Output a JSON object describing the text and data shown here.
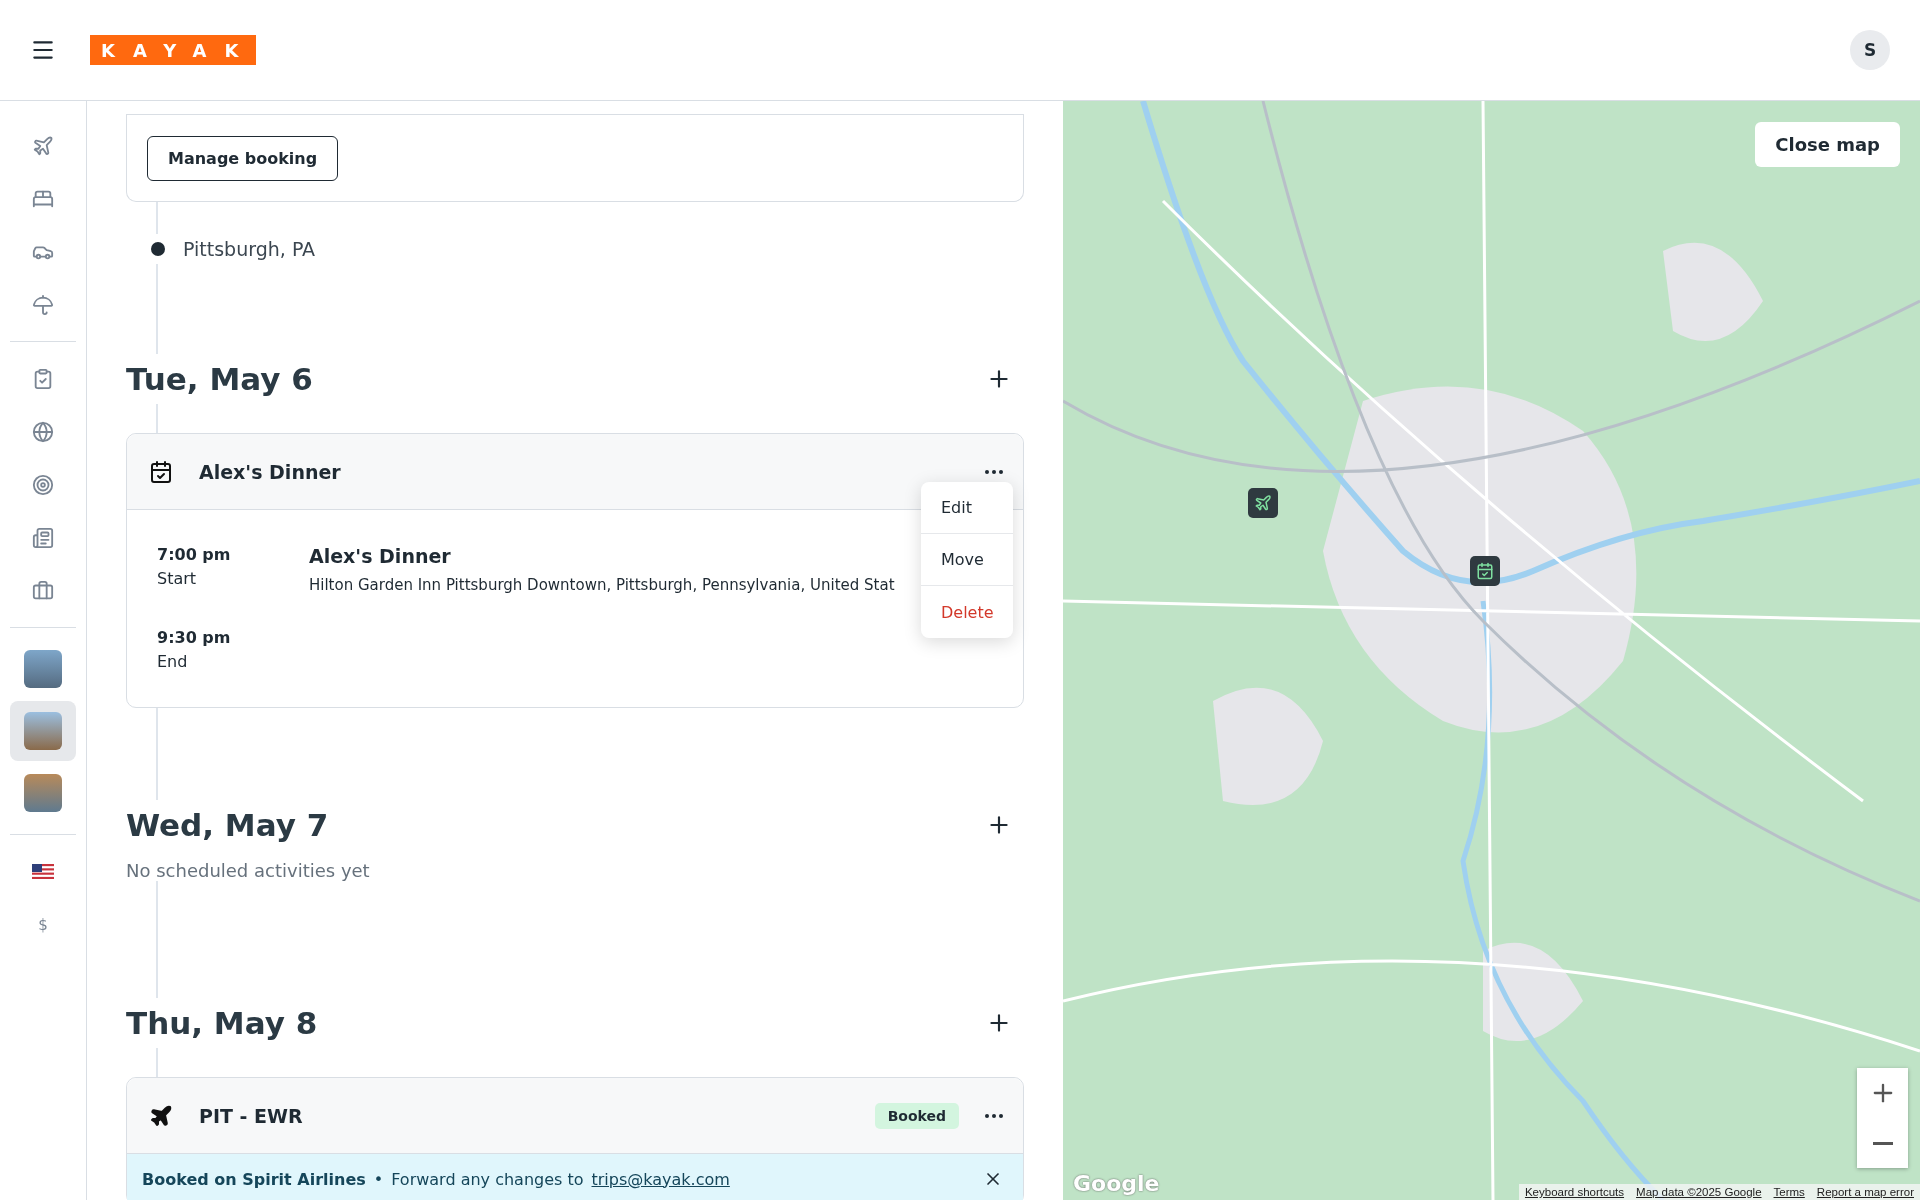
{
  "header": {
    "logo": "KAYAK",
    "avatar_initial": "S"
  },
  "sidebar": {
    "trips": [
      {
        "selected": false
      },
      {
        "selected": true
      },
      {
        "selected": false
      }
    ],
    "currency": "$"
  },
  "itinerary": {
    "top_card": {
      "button": "Manage booking"
    },
    "location": "Pittsburgh, PA",
    "days": [
      {
        "date": "Tue, May 6",
        "events": [
          {
            "kind": "activity",
            "title": "Alex's Dinner",
            "menu": [
              {
                "label": "Edit",
                "danger": false
              },
              {
                "label": "Move",
                "danger": false
              },
              {
                "label": "Delete",
                "danger": true
              }
            ],
            "details": {
              "start_time": "7:00 pm",
              "start_label": "Start",
              "end_time": "9:30 pm",
              "end_label": "End",
              "name": "Alex's Dinner",
              "address": "Hilton Garden Inn Pittsburgh Downtown, Pittsburgh, Pennsylvania, United Stat"
            }
          }
        ]
      },
      {
        "date": "Wed, May 7",
        "empty_text": "No scheduled activities yet"
      },
      {
        "date": "Thu, May 8",
        "events": [
          {
            "kind": "flight",
            "title": "PIT - EWR",
            "badge": "Booked",
            "notice": {
              "bold": "Booked on Spirit Airlines",
              "separator": "•",
              "text": "Forward any changes to",
              "link": "trips@kayak.com"
            }
          }
        ]
      }
    ]
  },
  "map": {
    "close_button": "Close map",
    "logo": "Google",
    "attribution": [
      "Keyboard shortcuts",
      "Map data ©2025 Google",
      "Terms",
      "Report a map error"
    ]
  }
}
